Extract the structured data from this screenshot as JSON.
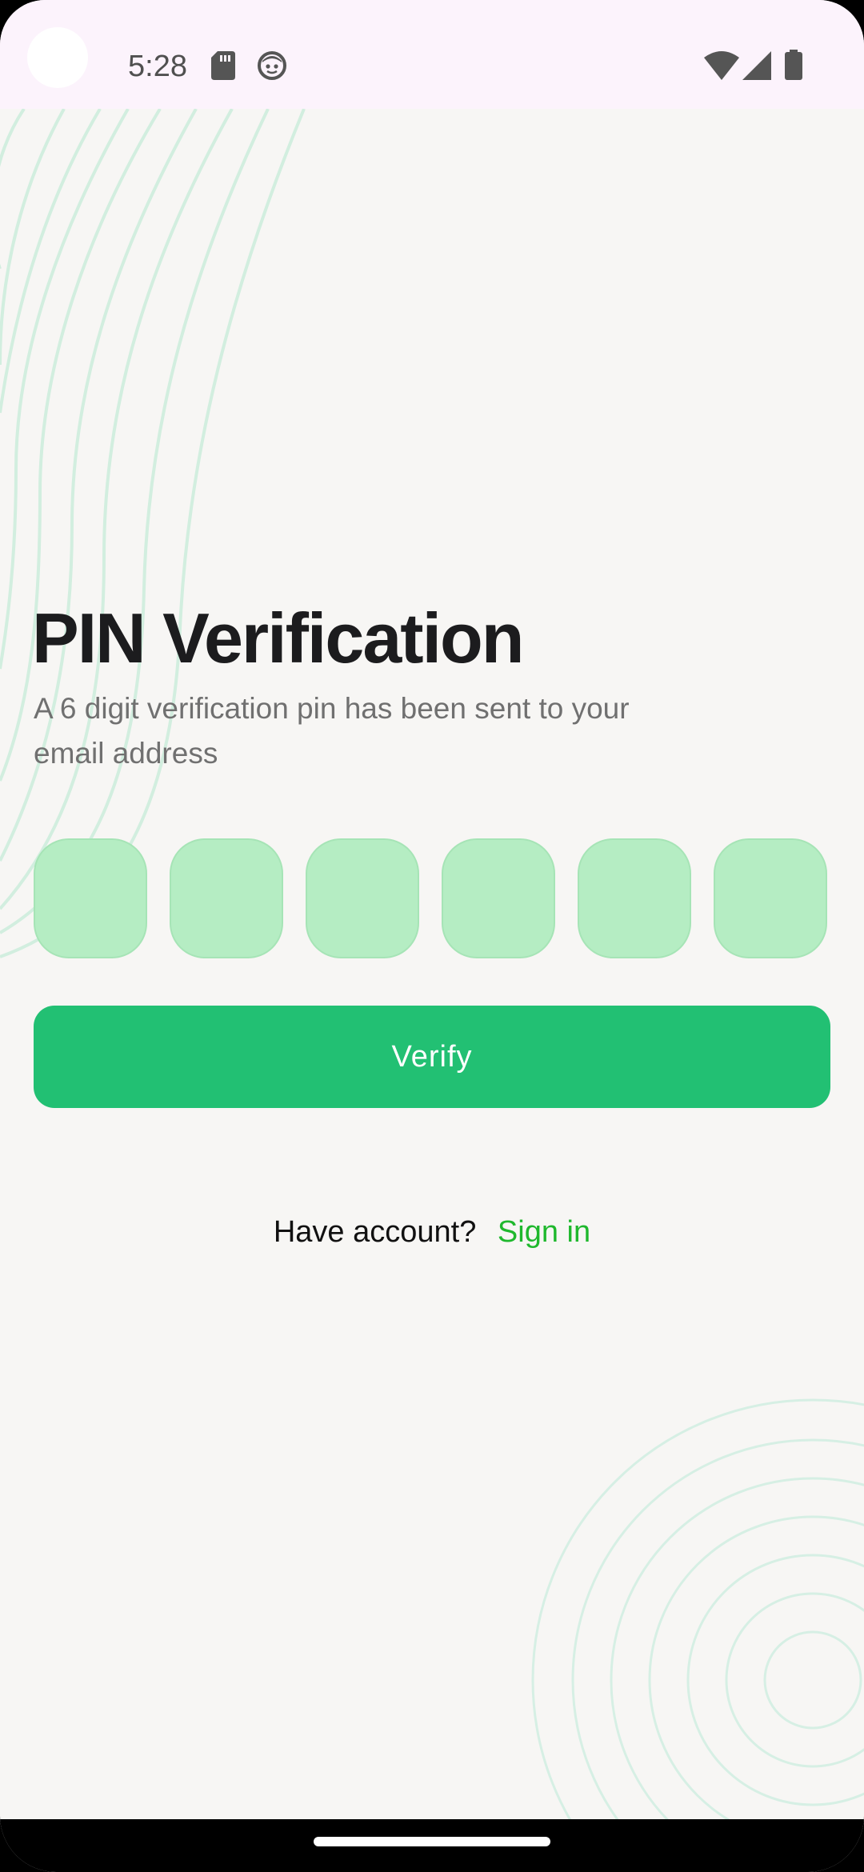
{
  "status_bar": {
    "time": "5:28",
    "icons": [
      "sd-card-icon",
      "face-icon",
      "wifi-icon",
      "signal-icon",
      "battery-icon"
    ]
  },
  "page": {
    "title": "PIN Verification",
    "subtitle": "A 6 digit verification pin has been sent to your email address"
  },
  "pin": {
    "length": 6,
    "values": [
      "",
      "",
      "",
      "",
      "",
      ""
    ]
  },
  "verify_button": {
    "label": "Verify"
  },
  "footer": {
    "prompt": "Have account?",
    "link_label": "Sign in"
  },
  "colors": {
    "accent_green": "#22c073",
    "link_green": "#1fb82d",
    "pin_box_fill": "#b5edc3",
    "background": "#f7f6f4",
    "status_bar_bg": "#fcf3fc",
    "decor_line": "#c8ecd8"
  }
}
